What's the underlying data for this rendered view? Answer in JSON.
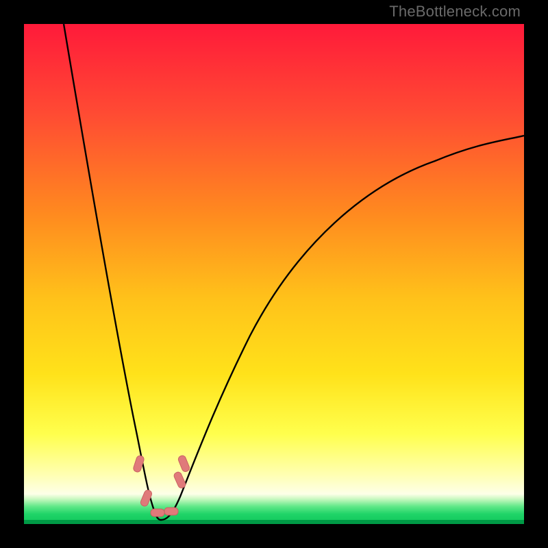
{
  "watermark": "TheBottleneck.com",
  "chart_data": {
    "type": "line",
    "title": "",
    "xlabel": "",
    "ylabel": "",
    "xlim": [
      0,
      100
    ],
    "ylim": [
      0,
      100
    ],
    "gradient_background": {
      "top": "#ff1a3a",
      "upper_mid": "#ff8a1f",
      "mid": "#ffd700",
      "lower_mid": "#ffff66",
      "pale": "#fdffd9",
      "bottom_band": "#20e070",
      "bottom_line": "#009944"
    },
    "curve": {
      "description": "V-shaped bottleneck curve with sharp dip to near 0 around x≈27 and asymptotic rise toward both sides",
      "minimum_x": 27,
      "minimum_y": 0,
      "left_top_y": 100,
      "left_top_x": 8,
      "right_top_y": 72,
      "right_top_x": 100
    },
    "markers": [
      {
        "x": 23.5,
        "y": 11.5
      },
      {
        "x": 25.0,
        "y": 4.5
      },
      {
        "x": 26.5,
        "y": 2.0
      },
      {
        "x": 28.5,
        "y": 2.0
      },
      {
        "x": 31.2,
        "y": 8.5
      },
      {
        "x": 31.8,
        "y": 11.0
      }
    ],
    "marker_color": "#e07a7a"
  }
}
